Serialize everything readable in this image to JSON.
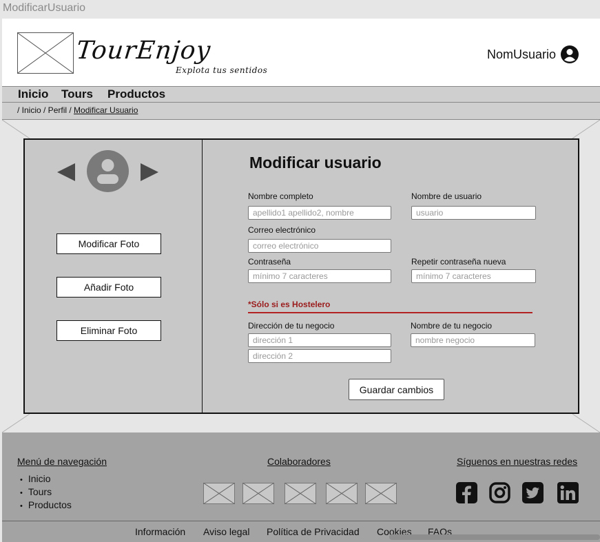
{
  "window": {
    "title": "ModificarUsuario"
  },
  "header": {
    "brand": "TourEnjoy",
    "slogan": "Explota tus sentidos",
    "username": "NomUsuario"
  },
  "nav": {
    "items": [
      "Inicio",
      "Tours",
      "Productos"
    ]
  },
  "breadcrumb": {
    "prefix": "/ Inicio / Perfil / ",
    "current": "Modificar Usuario"
  },
  "photo_panel": {
    "buttons": [
      "Modificar Foto",
      "Añadir Foto",
      "Eliminar Foto"
    ]
  },
  "form": {
    "title": "Modificar usuario",
    "full_name": {
      "label": "Nombre completo",
      "placeholder": "apellido1 apellido2, nombre"
    },
    "username": {
      "label": "Nombre de usuario",
      "placeholder": "usuario"
    },
    "email": {
      "label": "Correo electrónico",
      "placeholder": "correo electrónico"
    },
    "password": {
      "label": "Contraseña",
      "placeholder": "mínimo 7 caracteres"
    },
    "password_repeat": {
      "label": "Repetir contraseña nueva",
      "placeholder": "mínimo 7 caracteres"
    },
    "hostelero_note": "*Sólo si es Hostelero",
    "address": {
      "label": "Dirección de tu negocio",
      "placeholder1": "dirección 1",
      "placeholder2": "dirección 2"
    },
    "business_name": {
      "label": "Nombre de tu negocio",
      "placeholder": "nombre negocio"
    },
    "save_label": "Guardar cambios"
  },
  "footer": {
    "nav_heading": "Menú de navegación",
    "nav_items": [
      "Inicio",
      "Tours",
      "Productos"
    ],
    "collab_heading": "Colaboradores",
    "social_heading": "Síguenos en nuestras redes",
    "social_icons": [
      "facebook-icon",
      "instagram-icon",
      "twitter-icon",
      "linkedin-icon"
    ]
  },
  "bottom_links": [
    "Información",
    "Aviso legal",
    "Política de Privacidad",
    "Cookies",
    "FAQs"
  ],
  "colors": {
    "accent_red": "#b22222",
    "panel_gray": "#c8c8c8",
    "footer_gray": "#a3a3a3"
  }
}
